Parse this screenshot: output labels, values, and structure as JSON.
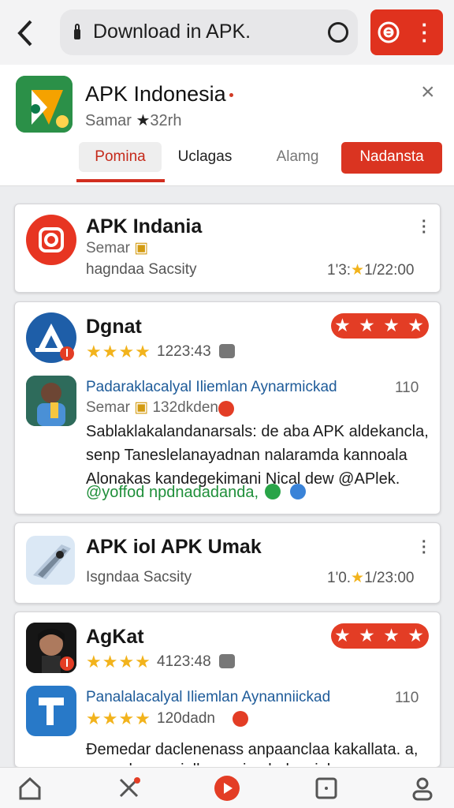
{
  "browser": {
    "url_text": "Download in APK.",
    "icons": [
      "back-arrow-icon",
      "lock-icon",
      "refresh-circle-icon",
      "menu-dots-icon"
    ]
  },
  "app_header": {
    "name": "APK Indonesia",
    "subtitle_prefix": "Samar",
    "subtitle_suffix": "32rh",
    "tabs": [
      {
        "label": "Pomina"
      },
      {
        "label": "Uclagas"
      },
      {
        "label": "Alamg"
      },
      {
        "label": "Nadansta"
      }
    ]
  },
  "cards": [
    {
      "title": "APK Indania",
      "line1": "Semar",
      "line2": "hagndaa Sacsity",
      "meta_prefix": "1'3:",
      "meta_suffix": "1/22:00"
    },
    {
      "title": "Dgnat",
      "rating_pill": "★ ★ ★ ★",
      "stars": "★★★★",
      "meta": "1223:43",
      "blue_title": "Padaraklacalyal Iliemlan Aynarmickad",
      "count": "110",
      "sub_prefix": "Semar",
      "sub_value": "132dkden",
      "body": [
        "Sablaklakalandanarsals: de aba APK aldekancla,",
        "senp Taneslelanayadnan nalaramda kannoala",
        "Alonakas kandegekimani Nical dew @APlek."
      ],
      "green": "@yoffod npdnadadanda,"
    },
    {
      "title": "APK iol APK Umak",
      "line": "Isgndaa Sacsity",
      "meta_prefix": "1'0.",
      "meta_suffix": "1/23:00"
    },
    {
      "title": "AgKat",
      "rating_pill": "★ ★ ★ ★",
      "stars": "★★★★",
      "meta": "4123:48",
      "blue_title": "Panalalacalyal Iliemlan Aynanniickad",
      "count": "110",
      "stars2": "★★★★",
      "meta2": "120dadn",
      "body": [
        "Ɖemedar daclenenass anpaanclaa kakallata. a,",
        "sennel ananeinlkanns inn balansieken"
      ]
    }
  ],
  "colors": {
    "accent": "#e0321e",
    "link": "#1e5b99",
    "star": "#f2b31c"
  }
}
